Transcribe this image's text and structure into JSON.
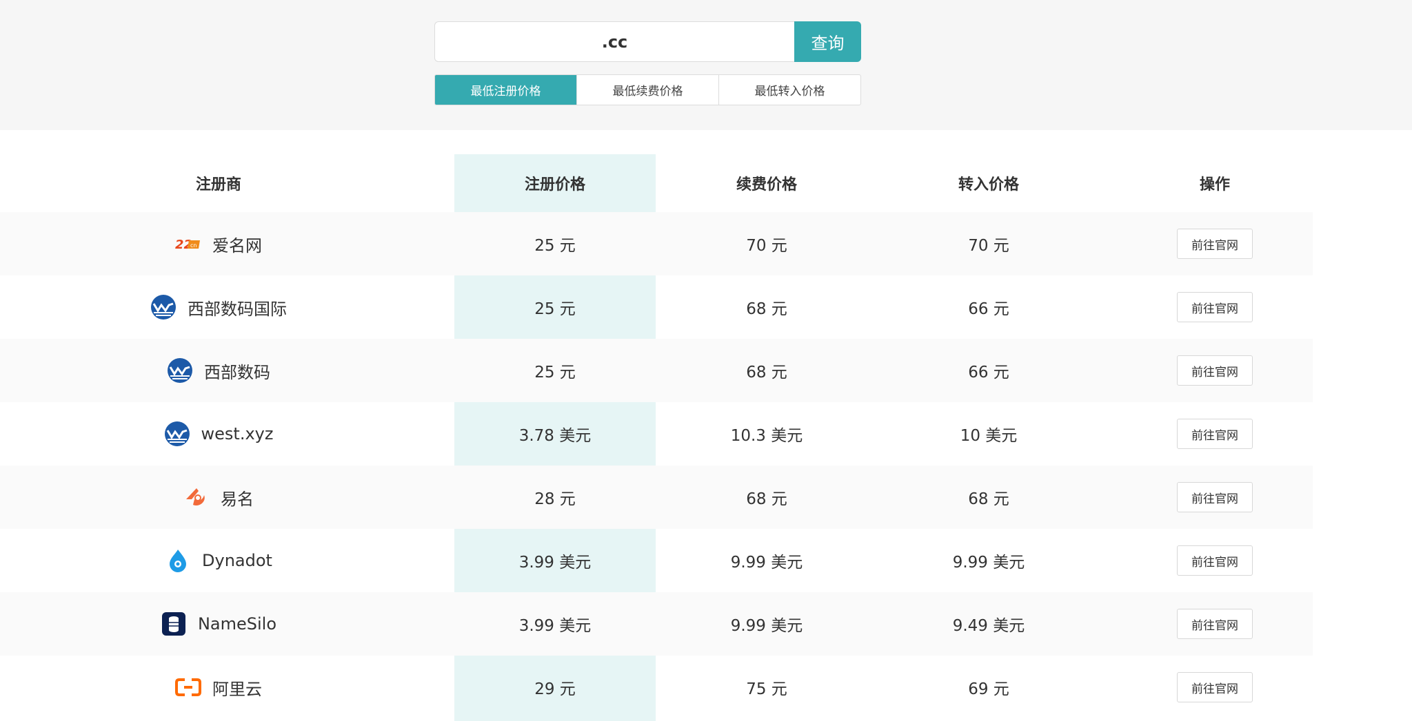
{
  "search": {
    "value": ".cc",
    "button_label": "查询"
  },
  "tabs": [
    {
      "label": "最低注册价格",
      "active": true
    },
    {
      "label": "最低续费价格",
      "active": false
    },
    {
      "label": "最低转入价格",
      "active": false
    }
  ],
  "table": {
    "headers": [
      "注册商",
      "注册价格",
      "续费价格",
      "转入价格",
      "操作"
    ],
    "rows": [
      {
        "name": "爱名网",
        "logo": "22cn-logo",
        "register": "25 元",
        "renew": "70 元",
        "transfer": "70 元",
        "action": "前往官网"
      },
      {
        "name": "西部数码国际",
        "logo": "west-logo",
        "register": "25 元",
        "renew": "68 元",
        "transfer": "66 元",
        "action": "前往官网"
      },
      {
        "name": "西部数码",
        "logo": "west-logo",
        "register": "25 元",
        "renew": "68 元",
        "transfer": "66 元",
        "action": "前往官网"
      },
      {
        "name": "west.xyz",
        "logo": "west-logo",
        "register": "3.78 美元",
        "renew": "10.3 美元",
        "transfer": "10 美元",
        "action": "前往官网"
      },
      {
        "name": "易名",
        "logo": "ename-logo",
        "register": "28 元",
        "renew": "68 元",
        "transfer": "68 元",
        "action": "前往官网"
      },
      {
        "name": "Dynadot",
        "logo": "dynadot-logo",
        "register": "3.99 美元",
        "renew": "9.99 美元",
        "transfer": "9.99 美元",
        "action": "前往官网"
      },
      {
        "name": "NameSilo",
        "logo": "namesilo-logo",
        "register": "3.99 美元",
        "renew": "9.99 美元",
        "transfer": "9.49 美元",
        "action": "前往官网"
      },
      {
        "name": "阿里云",
        "logo": "aliyun-logo",
        "register": "29 元",
        "renew": "75 元",
        "transfer": "69 元",
        "action": "前往官网"
      }
    ]
  },
  "colors": {
    "accent": "#35aab0",
    "top_bg": "#f6f6f6",
    "row_alt": "#fafafa"
  }
}
